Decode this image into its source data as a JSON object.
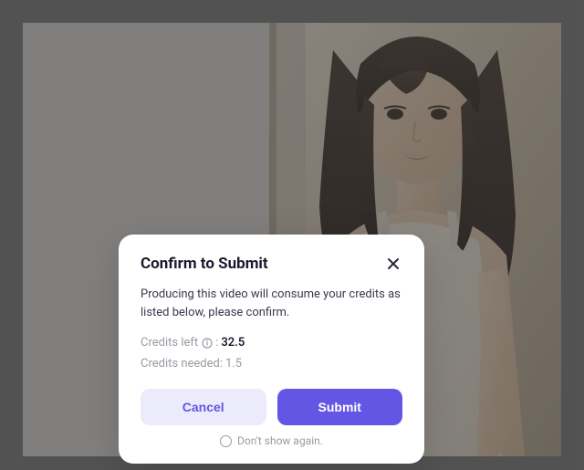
{
  "modal": {
    "title": "Confirm to Submit",
    "description": "Producing this video will consume your credits as listed below, please confirm.",
    "credits_left_label": "Credits left",
    "credits_left_separator": " : ",
    "credits_left_value": "32.5",
    "credits_needed_label": "Credits needed: ",
    "credits_needed_value": "1.5",
    "cancel_label": "Cancel",
    "submit_label": "Submit",
    "dont_show_label": "Don't show again."
  },
  "colors": {
    "accent": "#6356e5",
    "cancel_bg": "#ecebfb"
  }
}
